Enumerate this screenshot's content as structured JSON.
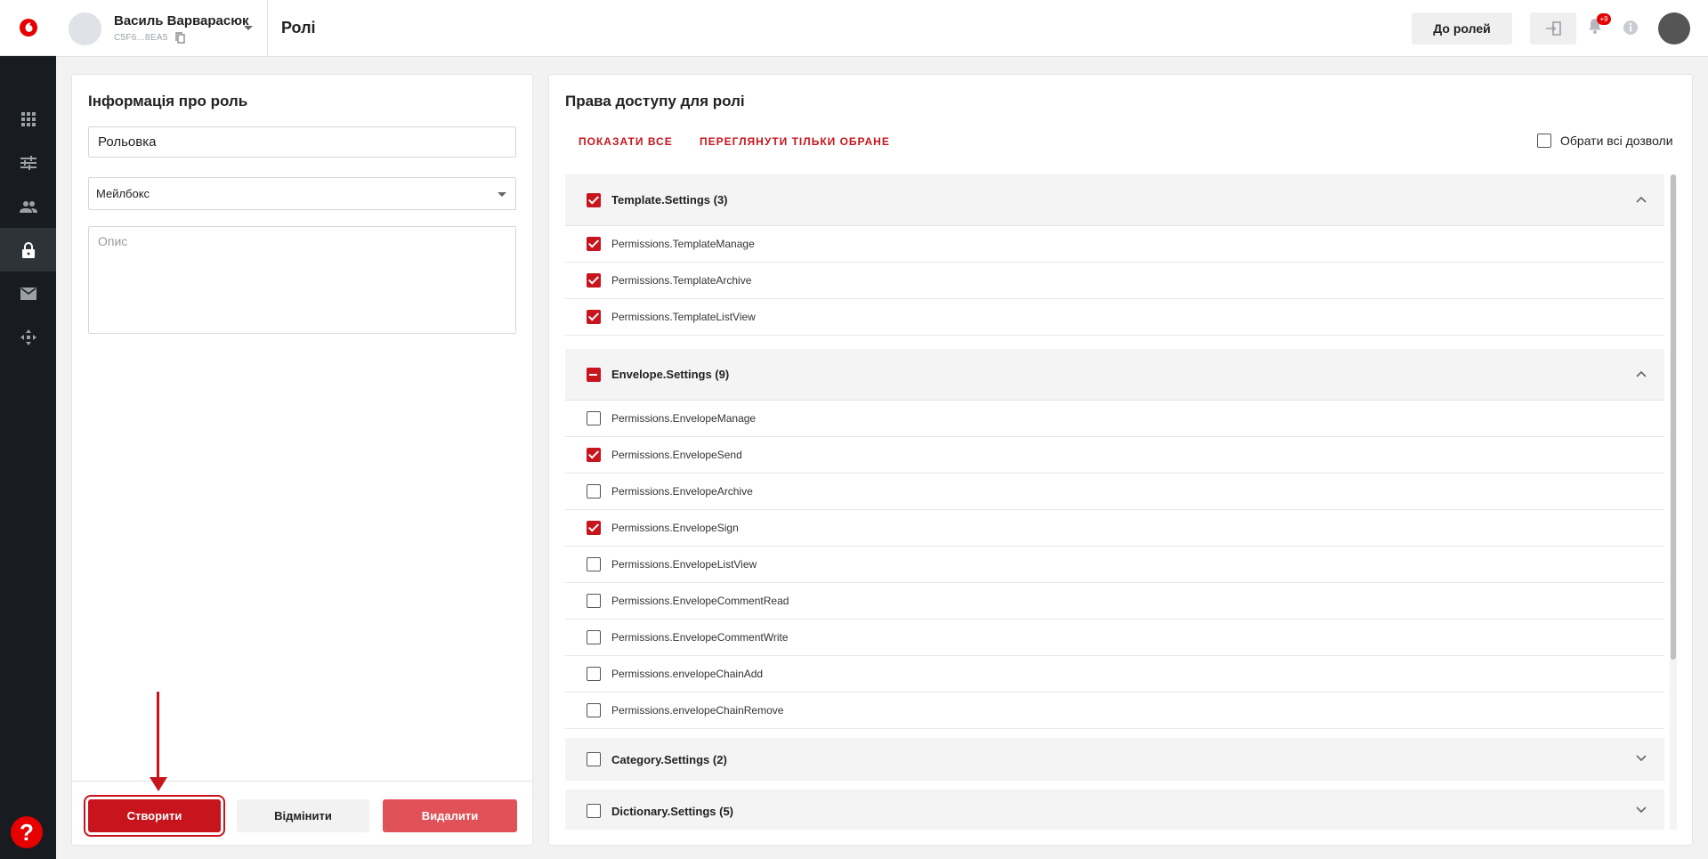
{
  "header": {
    "user_name": "Василь Варварасюк",
    "user_id": "C5F6...8EA5",
    "page_title": "Ролі",
    "roles_button": "До ролей",
    "notification_badge": "+9"
  },
  "sidebar": {
    "items": [
      {
        "icon": "apps-grid-icon"
      },
      {
        "icon": "sliders-icon"
      },
      {
        "icon": "people-icon"
      },
      {
        "icon": "lock-icon",
        "active": true
      },
      {
        "icon": "mail-icon"
      },
      {
        "icon": "move-arrows-icon"
      }
    ],
    "help": "?"
  },
  "role_info": {
    "title": "Інформація про роль",
    "name_value": "Рольовка",
    "type_value": "Мейлбокс",
    "description_placeholder": "Опис",
    "create_button": "Створити",
    "cancel_button": "Відмінити",
    "delete_button": "Видалити"
  },
  "permissions": {
    "title": "Права доступу для ролі",
    "show_all": "ПОКАЗАТИ ВСЕ",
    "view_selected": "ПЕРЕГЛЯНУТИ ТІЛЬКИ ОБРАНЕ",
    "select_all_label": "Обрати всі дозволи",
    "groups": [
      {
        "label": "Template.Settings (3)",
        "state": "checked",
        "expanded": true,
        "items": [
          {
            "label": "Permissions.TemplateManage",
            "checked": true
          },
          {
            "label": "Permissions.TemplateArchive",
            "checked": true
          },
          {
            "label": "Permissions.TemplateListView",
            "checked": true
          }
        ]
      },
      {
        "label": "Envelope.Settings (9)",
        "state": "partial",
        "expanded": true,
        "items": [
          {
            "label": "Permissions.EnvelopeManage",
            "checked": false
          },
          {
            "label": "Permissions.EnvelopeSend",
            "checked": true
          },
          {
            "label": "Permissions.EnvelopeArchive",
            "checked": false
          },
          {
            "label": "Permissions.EnvelopeSign",
            "checked": true
          },
          {
            "label": "Permissions.EnvelopeListView",
            "checked": false
          },
          {
            "label": "Permissions.EnvelopeCommentRead",
            "checked": false
          },
          {
            "label": "Permissions.EnvelopeCommentWrite",
            "checked": false
          },
          {
            "label": "Permissions.envelopeChainAdd",
            "checked": false
          },
          {
            "label": "Permissions.envelopeChainRemove",
            "checked": false
          }
        ]
      },
      {
        "label": "Category.Settings (2)",
        "state": "unchecked",
        "expanded": false,
        "items": []
      },
      {
        "label": "Dictionary.Settings (5)",
        "state": "unchecked",
        "expanded": false,
        "items": []
      }
    ]
  },
  "colors": {
    "accent": "#c8141c",
    "sidebar_bg": "#181c20",
    "delete_bg": "#e05257"
  }
}
